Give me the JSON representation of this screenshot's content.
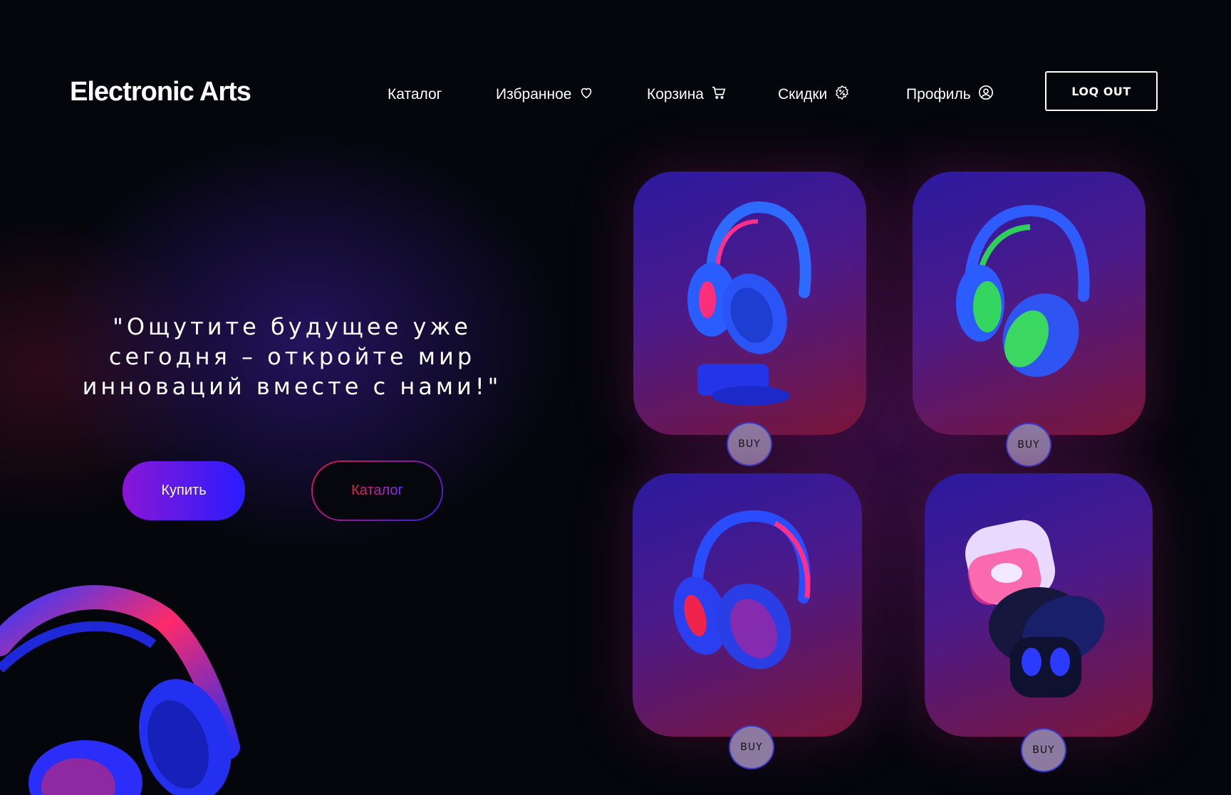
{
  "header": {
    "logo": "Electronic Arts",
    "nav": [
      {
        "label": "Каталог",
        "icon": ""
      },
      {
        "label": "Избранное",
        "icon": "heart-icon"
      },
      {
        "label": "Корзина",
        "icon": "cart-icon"
      },
      {
        "label": "Скидки",
        "icon": "discount-badge-icon"
      },
      {
        "label": "Профиль",
        "icon": "user-circle-icon"
      }
    ],
    "logout_label": "LOQ OUT"
  },
  "hero": {
    "lines": [
      "\"Ощутите будущее уже",
      "сегодня – откройте мир",
      "инноваций вместе с нами!\""
    ],
    "buy_button": "Купить",
    "catalog_button": "Каталог"
  },
  "products": [
    {
      "image": "blue-pink-headphones-on-stand",
      "buy_label": "BUY"
    },
    {
      "image": "blue-green-headphones",
      "buy_label": "BUY"
    },
    {
      "image": "blue-red-headphones",
      "buy_label": "BUY"
    },
    {
      "image": "wireless-earbuds-cases",
      "buy_label": "BUY"
    }
  ],
  "colors": {
    "background": "#05060c",
    "buy_gradient": [
      "#8a16d6",
      "#2a1cff"
    ],
    "catalog_gradient": [
      "#f0203e",
      "#7a2cff"
    ],
    "card_gradient": [
      "#2a1a9e",
      "#7a1638"
    ]
  }
}
